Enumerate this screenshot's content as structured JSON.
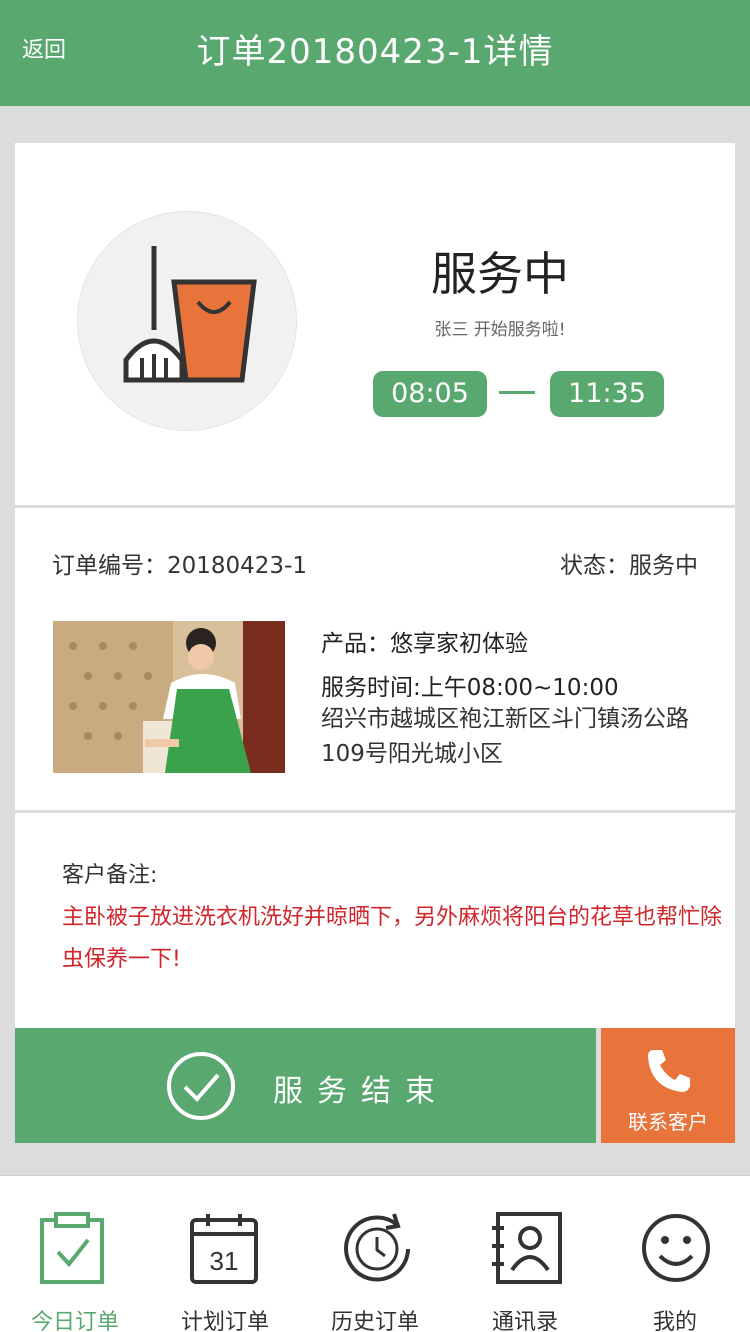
{
  "header": {
    "back_label": "返回",
    "title": "订单20180423-1详情"
  },
  "status_card": {
    "status": "服务中",
    "subtitle": "张三 开始服务啦!",
    "start_time": "08:05",
    "end_time": "11:35"
  },
  "order": {
    "number_label": "订单编号：20180423-1",
    "status_label": "状态：服务中",
    "product": "产品：悠享家初体验",
    "service_time": "服务时间:上午08:00~10:00",
    "address": "绍兴市越城区袍江新区斗门镇汤公路109号阳光城小区"
  },
  "remark": {
    "label": "客户备注:",
    "text": "主卧被子放进洗衣机洗好并晾晒下，另外麻烦将阳台的花草也帮忙除虫保养一下!"
  },
  "actions": {
    "end_service": "服务结束",
    "contact_customer": "联系客户"
  },
  "tabs": [
    {
      "label": "今日订单",
      "icon": "clipboard-check-icon"
    },
    {
      "label": "计划订单",
      "icon": "calendar-icon",
      "calendar_day": "31"
    },
    {
      "label": "历史订单",
      "icon": "history-clock-icon"
    },
    {
      "label": "通讯录",
      "icon": "contacts-icon"
    },
    {
      "label": "我的",
      "icon": "smiley-icon"
    }
  ],
  "colors": {
    "primary": "#58a86f",
    "accent": "#e8743b",
    "remark": "#d0252b"
  }
}
